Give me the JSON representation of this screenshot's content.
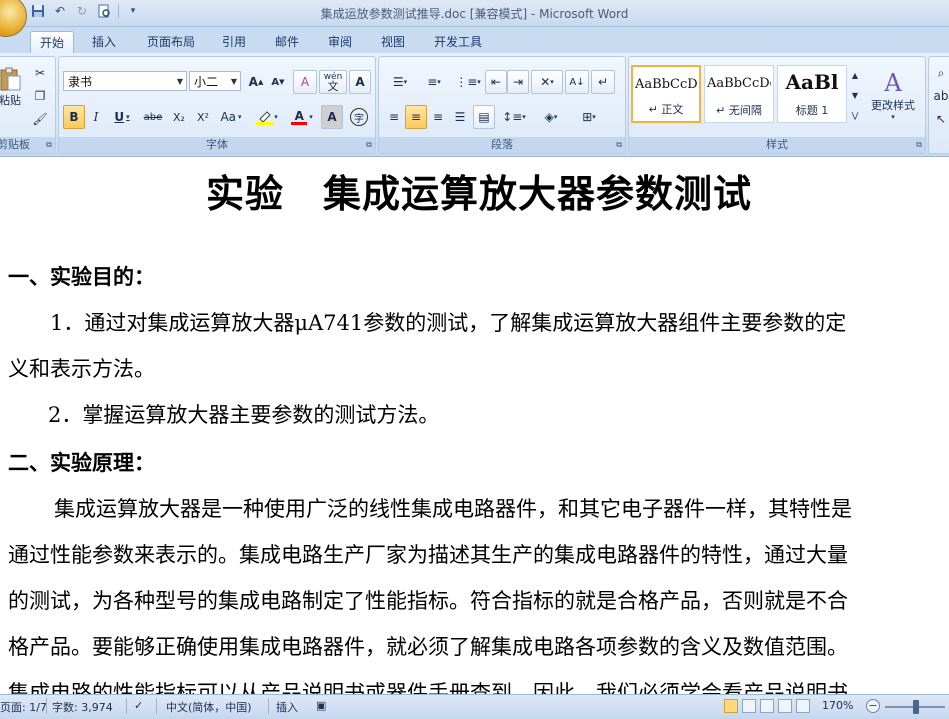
{
  "window": {
    "title": "集成运放参数测试推导.doc [兼容模式] - Microsoft Word"
  },
  "quick_access": {
    "save_icon": "save-icon",
    "undo_icon": "undo-icon",
    "redo_icon": "redo-icon",
    "print_preview_icon": "print-preview-icon",
    "customize_icon": "customize-qat-icon"
  },
  "tabs": [
    "开始",
    "插入",
    "页面布局",
    "引用",
    "邮件",
    "审阅",
    "视图",
    "开发工具"
  ],
  "ribbon": {
    "clipboard": {
      "label": "剪贴板",
      "paste_label": "粘贴"
    },
    "font": {
      "label": "字体",
      "font_name": "隶书",
      "font_size": "小二",
      "bold": "B",
      "italic": "I",
      "underline": "U",
      "strike": "abe",
      "subscript": "X₂",
      "superscript": "X²",
      "change_case": "Aa",
      "grow": "A",
      "shrink": "A",
      "clear": "A",
      "phonetic": "wén",
      "char_border": "A",
      "char_shading": "A",
      "enclose": "字",
      "highlight_color": "#ffff00",
      "font_color": "#ff0000"
    },
    "paragraph": {
      "label": "段落"
    },
    "styles": {
      "label": "样式",
      "items": [
        {
          "sample": "AaBbCcDc",
          "name": "↵ 正文"
        },
        {
          "sample": "AaBbCcDc",
          "name": "↵ 无间隔"
        },
        {
          "sample": "AaBl",
          "name": "标题 1"
        }
      ],
      "change_styles": "更改样式"
    }
  },
  "document": {
    "title": "实验　集成运算放大器参数测试",
    "lines": [
      "一、实验目的：",
      "1．通过对集成运算放大器μA741参数的测试，了解集成运算放大器组件主要参数的定",
      "义和表示方法。",
      "2．掌握运算放大器主要参数的测试方法。",
      "二、实验原理：",
      "集成运算放大器是一种使用广泛的线性集成电路器件，和其它电子器件一样，其特性是",
      "通过性能参数来表示的。集成电路生产厂家为描述其生产的集成电路器件的特性，通过大量",
      "的测试，为各种型号的集成电路制定了性能指标。符合指标的就是合格产品，否则就是不合",
      "格产品。要能够正确使用集成电路器件，就必须了解集成电路各项参数的含义及数值范围。",
      "集成电路的性能指标可以从产品说明书或器件手册查到，因此，我们必须学会看产品说明书"
    ]
  },
  "status": {
    "page": "页面: 1/7",
    "words": "字数: 3,974",
    "language": "中文(简体，中国)",
    "mode": "插入",
    "zoom": "170%"
  }
}
